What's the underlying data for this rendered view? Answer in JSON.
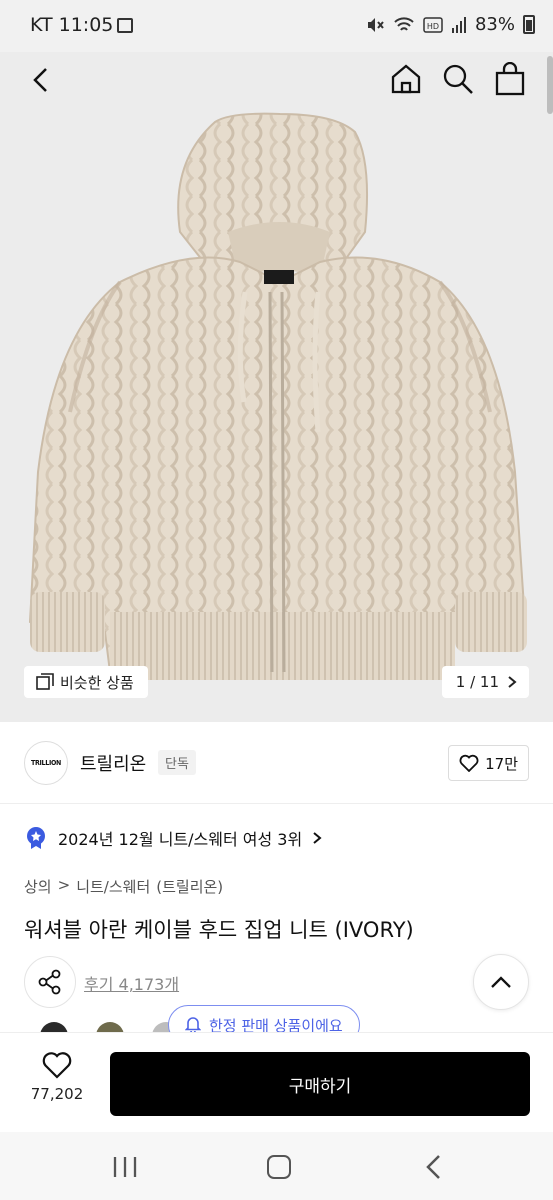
{
  "status_bar": {
    "time": "KT 11:05",
    "battery": "83%"
  },
  "gallery": {
    "similar_label": "비슷한 상품",
    "pager": "1 / 11"
  },
  "brand": {
    "logo_text": "TRILLION",
    "name": "트릴리온",
    "badge": "단독",
    "likes": "17만"
  },
  "product": {
    "rank": "2024년 12월 니트/스웨터 여성 3위",
    "breadcrumb": [
      "상의",
      ">",
      "니트/스웨터",
      "(트릴리온)"
    ],
    "title": "워셔블 아란 케이블 후드 집업 니트 (IVORY)",
    "reviews": "후기 4,173개",
    "limited_label": "한정 판매 상품이에요"
  },
  "colors": {
    "accent": "#4d63e6",
    "buy_button": "#000000",
    "sweater": "#e6dccd"
  },
  "buy_bar": {
    "wish_count": "77,202",
    "buy_label": "구매하기"
  }
}
